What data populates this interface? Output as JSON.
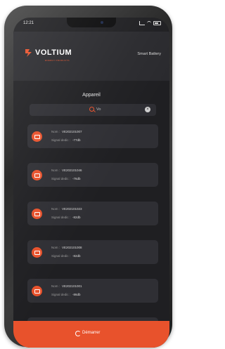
{
  "status_bar": {
    "time": "12:21"
  },
  "header": {
    "brand": "VOLTIUM",
    "tagline": "ENERGY PRODUCTS",
    "right_label": "Smart Battery"
  },
  "section": {
    "title": "Appareil"
  },
  "search": {
    "value": "Vo",
    "search_icon": "search-icon",
    "clear_icon": "close-icon"
  },
  "devices": [
    {
      "name_label": "Nom :",
      "name": "VE202101007",
      "signal_label": "Signal dedic :",
      "signal": "-77db"
    },
    {
      "name_label": "Nom :",
      "name": "VE202101046",
      "signal_label": "Signal dedic :",
      "signal": "-76db"
    },
    {
      "name_label": "Nom :",
      "name": "VE202101023",
      "signal_label": "Signal dedic :",
      "signal": "-82db"
    },
    {
      "name_label": "Nom :",
      "name": "VE202101008",
      "signal_label": "Signal dedic :",
      "signal": "-82db"
    },
    {
      "name_label": "Nom :",
      "name": "VE202101001",
      "signal_label": "Signal dedic :",
      "signal": "-86db"
    },
    {
      "name_label": "Nom :",
      "name": "VE202101042",
      "signal_label": "Signal dedic :",
      "signal": "-87db"
    }
  ],
  "bottom": {
    "label": "Démarrer",
    "icon": "refresh-icon"
  },
  "colors": {
    "accent": "#e8522c",
    "background": "#1f1f22",
    "card": "#2f2f34"
  }
}
